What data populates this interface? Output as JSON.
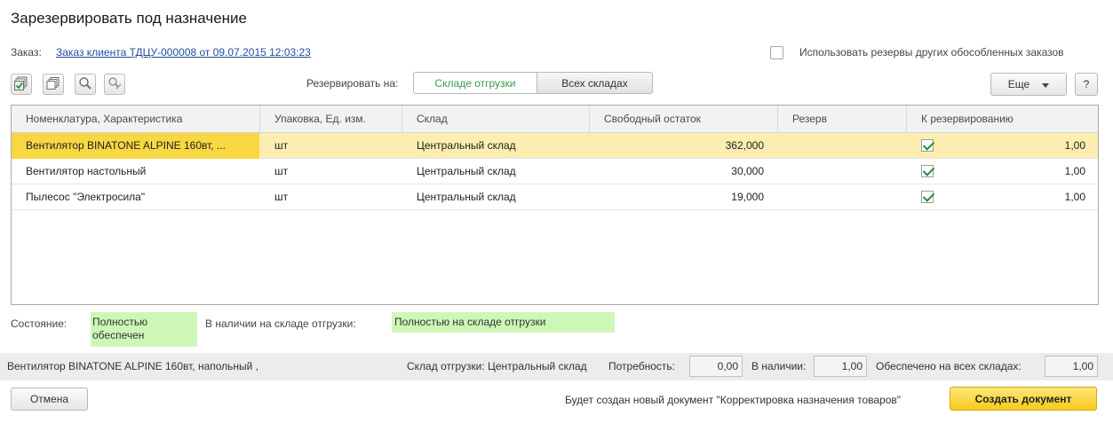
{
  "window": {
    "title": "Зарезервировать под назначение"
  },
  "order": {
    "label": "Заказ:",
    "link": "Заказ клиента ТДЦУ-000008 от 09.07.2015 12:03:23",
    "use_other_reserves_label": "Использовать резервы других обособленных заказов",
    "use_other_reserves_checked": false
  },
  "toolbar": {
    "reserve_on_label": "Резервировать на:",
    "segment_shipping": "Складе отгрузки",
    "segment_all": "Всех складах",
    "active_segment": "Складе отгрузки",
    "more_label": "Еще",
    "help_label": "?",
    "icons": [
      "check-all-icon",
      "copy-icon",
      "search-icon",
      "clear-icon"
    ]
  },
  "table": {
    "columns": [
      "Номенклатура, Характеристика",
      "Упаковка, Ед. изм.",
      "Склад",
      "Свободный остаток",
      "Резерв",
      "К резервированию"
    ],
    "rows": [
      {
        "name": "Вентилятор BINATONE ALPINE 160вт, ...",
        "unit": "шт",
        "warehouse": "Центральный склад",
        "free": "362,000",
        "reserve": "",
        "checked": true,
        "to_reserve": "1,00",
        "selected": true
      },
      {
        "name": "Вентилятор настольный",
        "unit": "шт",
        "warehouse": "Центральный склад",
        "free": "30,000",
        "reserve": "",
        "checked": true,
        "to_reserve": "1,00",
        "selected": false
      },
      {
        "name": "Пылесос \"Электросила\"",
        "unit": "шт",
        "warehouse": "Центральный склад",
        "free": "19,000",
        "reserve": "",
        "checked": true,
        "to_reserve": "1,00",
        "selected": false
      }
    ]
  },
  "state": {
    "label": "Состояние:",
    "value_line1": "Полностью",
    "value_line2": "обеспечен",
    "avail_label": "В наличии на складе отгрузки:",
    "avail_value": "Полностью на складе отгрузки"
  },
  "status_bar": {
    "item": "Вентилятор BINATONE ALPINE 160вт, напольный ,",
    "warehouse": "Склад отгрузки: Центральный склад",
    "need_label": "Потребность:",
    "need_value": "0,00",
    "available_label": "В наличии:",
    "available_value": "1,00",
    "all_label": "Обеспечено на всех складах:",
    "all_value": "1,00"
  },
  "footer": {
    "cancel_label": "Отмена",
    "message": "Будет создан новый документ \"Корректировка назначения товаров\"",
    "create_label": "Создать документ"
  },
  "colors": {
    "selected_row": "#fbeeb0",
    "selected_cell": "#f8d743",
    "status_green": "#cdf7b7",
    "primary_button": "#f5cb1c",
    "link": "#1f4e9a"
  }
}
